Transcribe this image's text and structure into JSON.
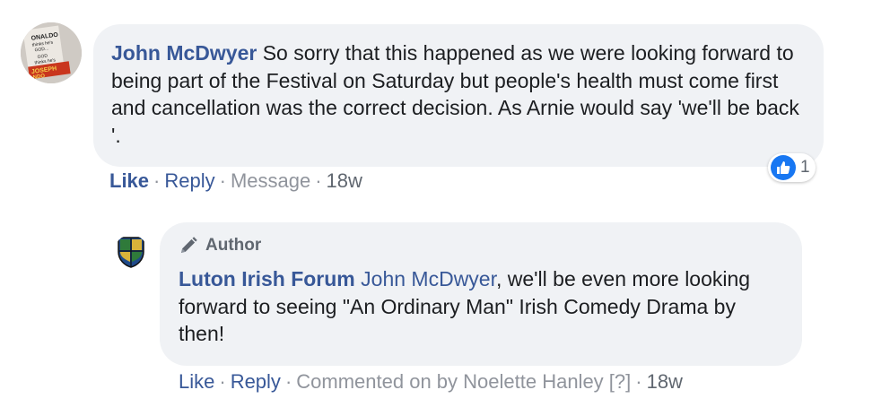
{
  "comment": {
    "author": "John McDwyer",
    "text": "So sorry that this happened as we were looking forward to being part of the Festival on Saturday but people's health must come first and cancellation was the correct decision. As Arnie would say 'we'll be back '.",
    "avatar_text": "ONALDO thinks he's GOD... GOD thinks he's JOSEPH NDO",
    "reaction_count": "1",
    "actions": {
      "like": "Like",
      "sep": "·",
      "reply": "Reply",
      "message": "Message",
      "time": "18w"
    }
  },
  "reply": {
    "author_badge": "Author",
    "author": "Luton Irish Forum",
    "mention": "John McDwyer",
    "text": ", we'll be even more looking forward to seeing \"An Ordinary Man\" Irish Comedy Drama by then!",
    "actions": {
      "like": "Like",
      "sep": "·",
      "reply": "Reply",
      "commented_on": "Commented on by Noelette Hanley [?]",
      "time": "18w"
    }
  },
  "colors": {
    "link_blue": "#385898",
    "bubble_bg": "#f0f2f5",
    "like_blue": "#1877f2",
    "muted": "#90949c"
  }
}
